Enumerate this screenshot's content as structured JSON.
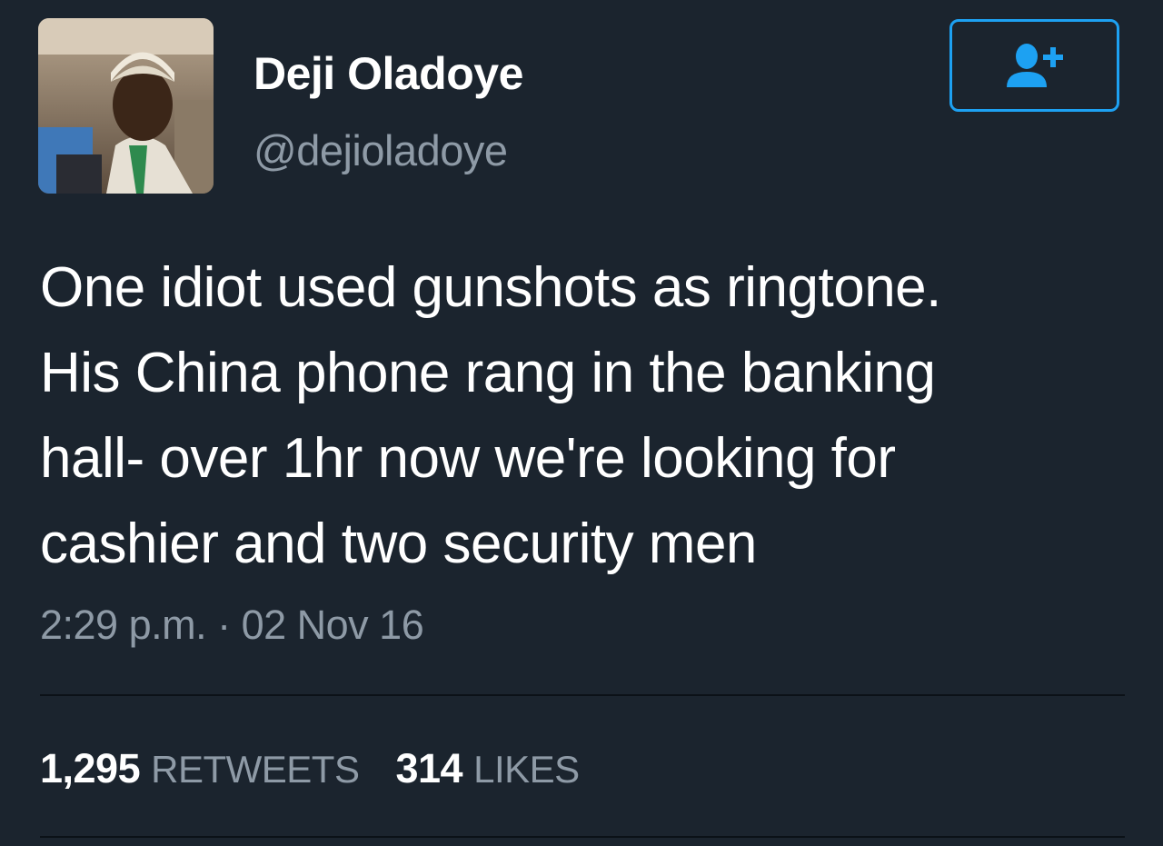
{
  "user": {
    "display_name": "Deji Oladoye",
    "handle": "@dejioladoye",
    "avatar_icon": "profile-photo"
  },
  "follow_button": {
    "icon": "add-user-icon",
    "accent": "#1da1f2"
  },
  "tweet": {
    "lines": [
      "One idiot used gunshots as ringtone.",
      "His China phone rang in the banking",
      "hall- over 1hr now we're looking for",
      "cashier and two security men"
    ],
    "timestamp": "2:29 p.m. · 02 Nov 16"
  },
  "stats": {
    "retweets_count": "1,295",
    "retweets_label": "RETWEETS",
    "likes_count": "314",
    "likes_label": "LIKES"
  },
  "colors": {
    "background": "#1b242e",
    "primary_text": "#ffffff",
    "secondary_text": "#8e9aa6",
    "accent": "#1da1f2"
  }
}
